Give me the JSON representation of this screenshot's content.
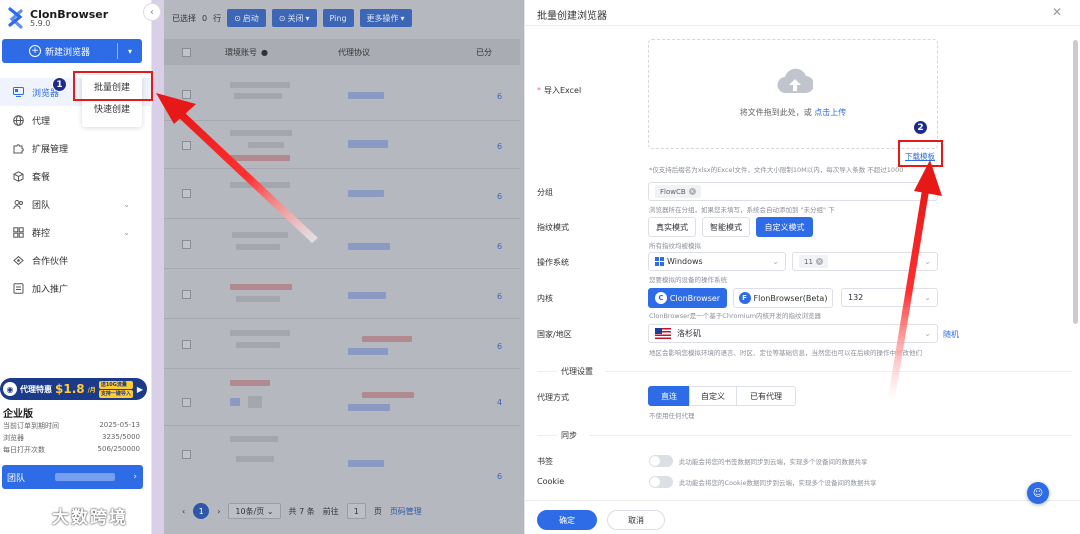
{
  "app": {
    "name": "ClonBrowser",
    "version": "5.9.0"
  },
  "sidebar": {
    "new_browser_label": "新建浏览器",
    "menu": [
      {
        "label": "浏览器",
        "icon": "monitor-icon",
        "active": true
      },
      {
        "label": "代理",
        "icon": "globe-icon"
      },
      {
        "label": "扩展管理",
        "icon": "puzzle-icon"
      },
      {
        "label": "套餐",
        "icon": "package-icon"
      },
      {
        "label": "团队",
        "icon": "team-icon",
        "has_chevron": true
      },
      {
        "label": "群控",
        "icon": "group-control-icon",
        "has_chevron": true
      },
      {
        "label": "合作伙伴",
        "icon": "partner-icon"
      },
      {
        "label": "加入推广",
        "icon": "promotion-icon"
      }
    ],
    "popover": {
      "batch_create": "批量创建",
      "quick_create": "快速创建"
    },
    "promo": {
      "prefix": "代理特惠",
      "price": "$1.8",
      "unit": "/月",
      "extra1": "送10G流量",
      "extra2": "支持一键导入"
    },
    "plan": {
      "name": "企业版",
      "rows": [
        {
          "label": "当前订单到期时间",
          "value": "2025-05-13"
        },
        {
          "label": "浏览器",
          "value": "3235/5000"
        },
        {
          "label": "每日打开次数",
          "value": "506/250000"
        }
      ]
    },
    "team_label": "团队",
    "watermark": "大数跨境"
  },
  "main": {
    "selected_prefix": "已选择",
    "selected_count": "0",
    "selected_suffix": "行",
    "toolbar": {
      "start": "启动",
      "close": "关闭",
      "ping": "Ping",
      "more": "更多操作"
    },
    "columns": {
      "env_account": "環境账号",
      "proxy": "代理协议",
      "assigned": "已分"
    },
    "row_numbers": [
      "6",
      "6",
      "6",
      "6",
      "6",
      "6",
      "4",
      "6"
    ],
    "pager": {
      "page": "1",
      "per_page": "10条/页",
      "total": "共 7 条",
      "goto": "前往",
      "goto_page": "1",
      "page_suffix": "页",
      "page_manage": "页码管理"
    }
  },
  "dialog": {
    "title": "批量创建浏览器",
    "import_label": "导入Excel",
    "upload_text": "将文件拖到此处，或",
    "upload_link": "点击上传",
    "download_template": "下载模板",
    "upload_hint": "*仅支持后缀名为xlsx的Excel文件，文件大小限制10M以内，每次导入条数 不超过1000",
    "group": {
      "label": "分组",
      "tag": "FlowCB",
      "hint": "浏览器所在分组，如果您未填写，系统会自动添加到 \"未分组\" 下"
    },
    "fingerprint": {
      "label": "指纹模式",
      "options": [
        "真实模式",
        "智能模式",
        "自定义模式"
      ],
      "selected": 2,
      "hint": "所有指纹均被模拟"
    },
    "os": {
      "label": "操作系统",
      "value": "Windows",
      "version": "11",
      "hint": "您要模拟的设备的操作系统"
    },
    "kernel": {
      "label": "内核",
      "options": [
        "ClonBrowser",
        "FlonBrowser(Beta)"
      ],
      "version": "132",
      "hint": "ClonBrowser是一个基于Chromium内核开发的指纹浏览器"
    },
    "region": {
      "label": "国家/地区",
      "value": "洛杉矶",
      "random": "随机",
      "hint": "地区会影响您模拟环境的语言、时区、定位等基础信息，当然您也可以在后续的操作中修改他们"
    },
    "proxy_section": "代理设置",
    "proxy_mode": {
      "label": "代理方式",
      "options": [
        "直连",
        "自定义",
        "已有代理"
      ],
      "selected": 0,
      "hint": "不使用任何代理"
    },
    "sync_section": "同步",
    "bookmarks": {
      "label": "书签",
      "hint": "此功能会将您的书签数据同步到云端，实现多个设备间的数据共享"
    },
    "cookie": {
      "label": "Cookie",
      "hint": "此功能会将您的Cookie数据同步到云端，实现多个设备间的数据共享"
    },
    "confirm": "确定",
    "cancel": "取消"
  },
  "annotations": {
    "step1": "1",
    "step2": "2"
  },
  "colors": {
    "primary": "#2e6be6",
    "highlight": "#e61818",
    "badge": "#1d2c8c"
  }
}
